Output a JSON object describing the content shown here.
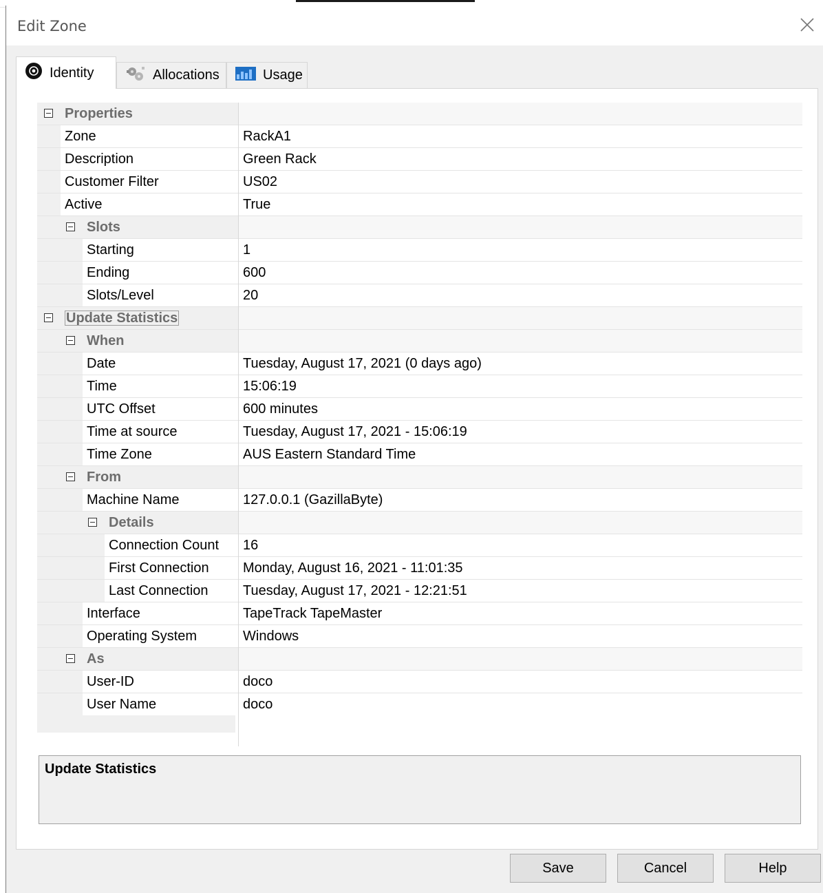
{
  "window": {
    "title": "Edit Zone"
  },
  "tabs": [
    {
      "label": "Identity",
      "icon": "at-sign-icon",
      "active": true
    },
    {
      "label": "Allocations",
      "icon": "gears-icon",
      "active": false
    },
    {
      "label": "Usage",
      "icon": "chart-icon",
      "active": false
    }
  ],
  "grid": {
    "properties": {
      "label": "Properties",
      "zone": {
        "label": "Zone",
        "value": "RackA1"
      },
      "description": {
        "label": "Description",
        "value": "Green Rack"
      },
      "customer_filter": {
        "label": "Customer Filter",
        "value": "US02"
      },
      "active": {
        "label": "Active",
        "value": "True"
      },
      "slots": {
        "label": "Slots",
        "starting": {
          "label": "Starting",
          "value": "1"
        },
        "ending": {
          "label": "Ending",
          "value": "600"
        },
        "slots_level": {
          "label": "Slots/Level",
          "value": "20"
        }
      }
    },
    "update_statistics": {
      "label": "Update Statistics",
      "when": {
        "label": "When",
        "date": {
          "label": "Date",
          "value": "Tuesday, August 17, 2021 (0 days ago)"
        },
        "time": {
          "label": "Time",
          "value": "15:06:19"
        },
        "utc_offset": {
          "label": "UTC Offset",
          "value": "600 minutes"
        },
        "time_at_source": {
          "label": "Time at source",
          "value": "Tuesday, August 17, 2021 - 15:06:19"
        },
        "time_zone": {
          "label": "Time Zone",
          "value": "AUS Eastern Standard Time"
        }
      },
      "from": {
        "label": "From",
        "machine_name": {
          "label": "Machine Name",
          "value": "127.0.0.1 (GazillaByte)"
        },
        "details": {
          "label": "Details",
          "connection_count": {
            "label": "Connection Count",
            "value": "16"
          },
          "first_connection": {
            "label": "First Connection",
            "value": "Monday, August 16, 2021 - 11:01:35"
          },
          "last_connection": {
            "label": "Last Connection",
            "value": "Tuesday, August 17, 2021 - 12:21:51"
          }
        },
        "interface": {
          "label": "Interface",
          "value": "TapeTrack TapeMaster"
        },
        "operating_system": {
          "label": "Operating System",
          "value": "Windows"
        }
      },
      "as": {
        "label": "As",
        "user_id": {
          "label": "User-ID",
          "value": "doco"
        },
        "user_name": {
          "label": "User Name",
          "value": "doco"
        }
      }
    }
  },
  "description_panel": {
    "title": "Update Statistics"
  },
  "buttons": {
    "save": "Save",
    "cancel": "Cancel",
    "help": "Help"
  },
  "colors": {
    "dialog_bg": "#f0f0f0",
    "category_text": "#6d6d6d",
    "button_bg": "#e1e1e1"
  }
}
